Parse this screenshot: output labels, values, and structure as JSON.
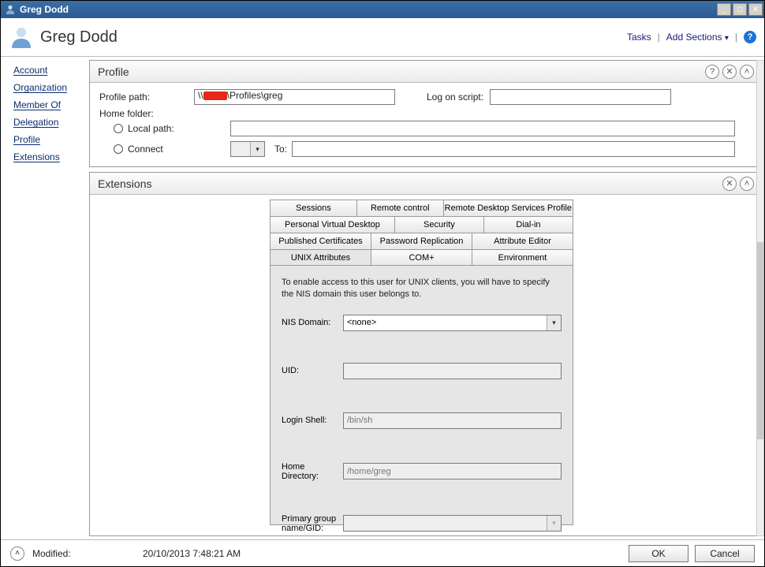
{
  "window": {
    "title": "Greg Dodd"
  },
  "header": {
    "title": "Greg Dodd",
    "tasks_label": "Tasks",
    "add_sections_label": "Add Sections"
  },
  "sidebar": {
    "items": [
      {
        "label": "Account"
      },
      {
        "label": "Organization"
      },
      {
        "label": "Member Of"
      },
      {
        "label": "Delegation"
      },
      {
        "label": "Profile"
      },
      {
        "label": "Extensions"
      }
    ]
  },
  "profile_section": {
    "title": "Profile",
    "profile_path_label": "Profile path:",
    "profile_path_prefix": "\\\\",
    "profile_path_suffix": "\\Profiles\\greg",
    "logon_script_label": "Log on script:",
    "logon_script_value": "",
    "home_folder_label": "Home folder:",
    "local_path_label": "Local path:",
    "local_path_value": "",
    "connect_label": "Connect",
    "drive_value": "",
    "to_label": "To:",
    "to_value": ""
  },
  "extensions_section": {
    "title": "Extensions",
    "tabs": {
      "row1": [
        "Sessions",
        "Remote control",
        "Remote Desktop Services Profile"
      ],
      "row2": [
        "Personal Virtual Desktop",
        "Security",
        "Dial-in"
      ],
      "row3": [
        "Published Certificates",
        "Password Replication",
        "Attribute Editor"
      ],
      "row4": [
        "UNIX Attributes",
        "COM+",
        "Environment"
      ]
    },
    "active_tab": "UNIX Attributes",
    "unix_panel": {
      "intro": "To enable access to this user for UNIX clients, you will have to specify the NIS domain this user belongs to.",
      "nis_domain_label": "NIS Domain:",
      "nis_domain_value": "<none>",
      "uid_label": "UID:",
      "uid_value": "",
      "login_shell_label": "Login Shell:",
      "login_shell_value": "/bin/sh",
      "home_dir_label": "Home Directory:",
      "home_dir_value": "/home/greg",
      "primary_gid_label": "Primary group name/GID:",
      "primary_gid_value": ""
    }
  },
  "statusbar": {
    "modified_label": "Modified:",
    "modified_value": "20/10/2013 7:48:21 AM",
    "ok_label": "OK",
    "cancel_label": "Cancel"
  }
}
